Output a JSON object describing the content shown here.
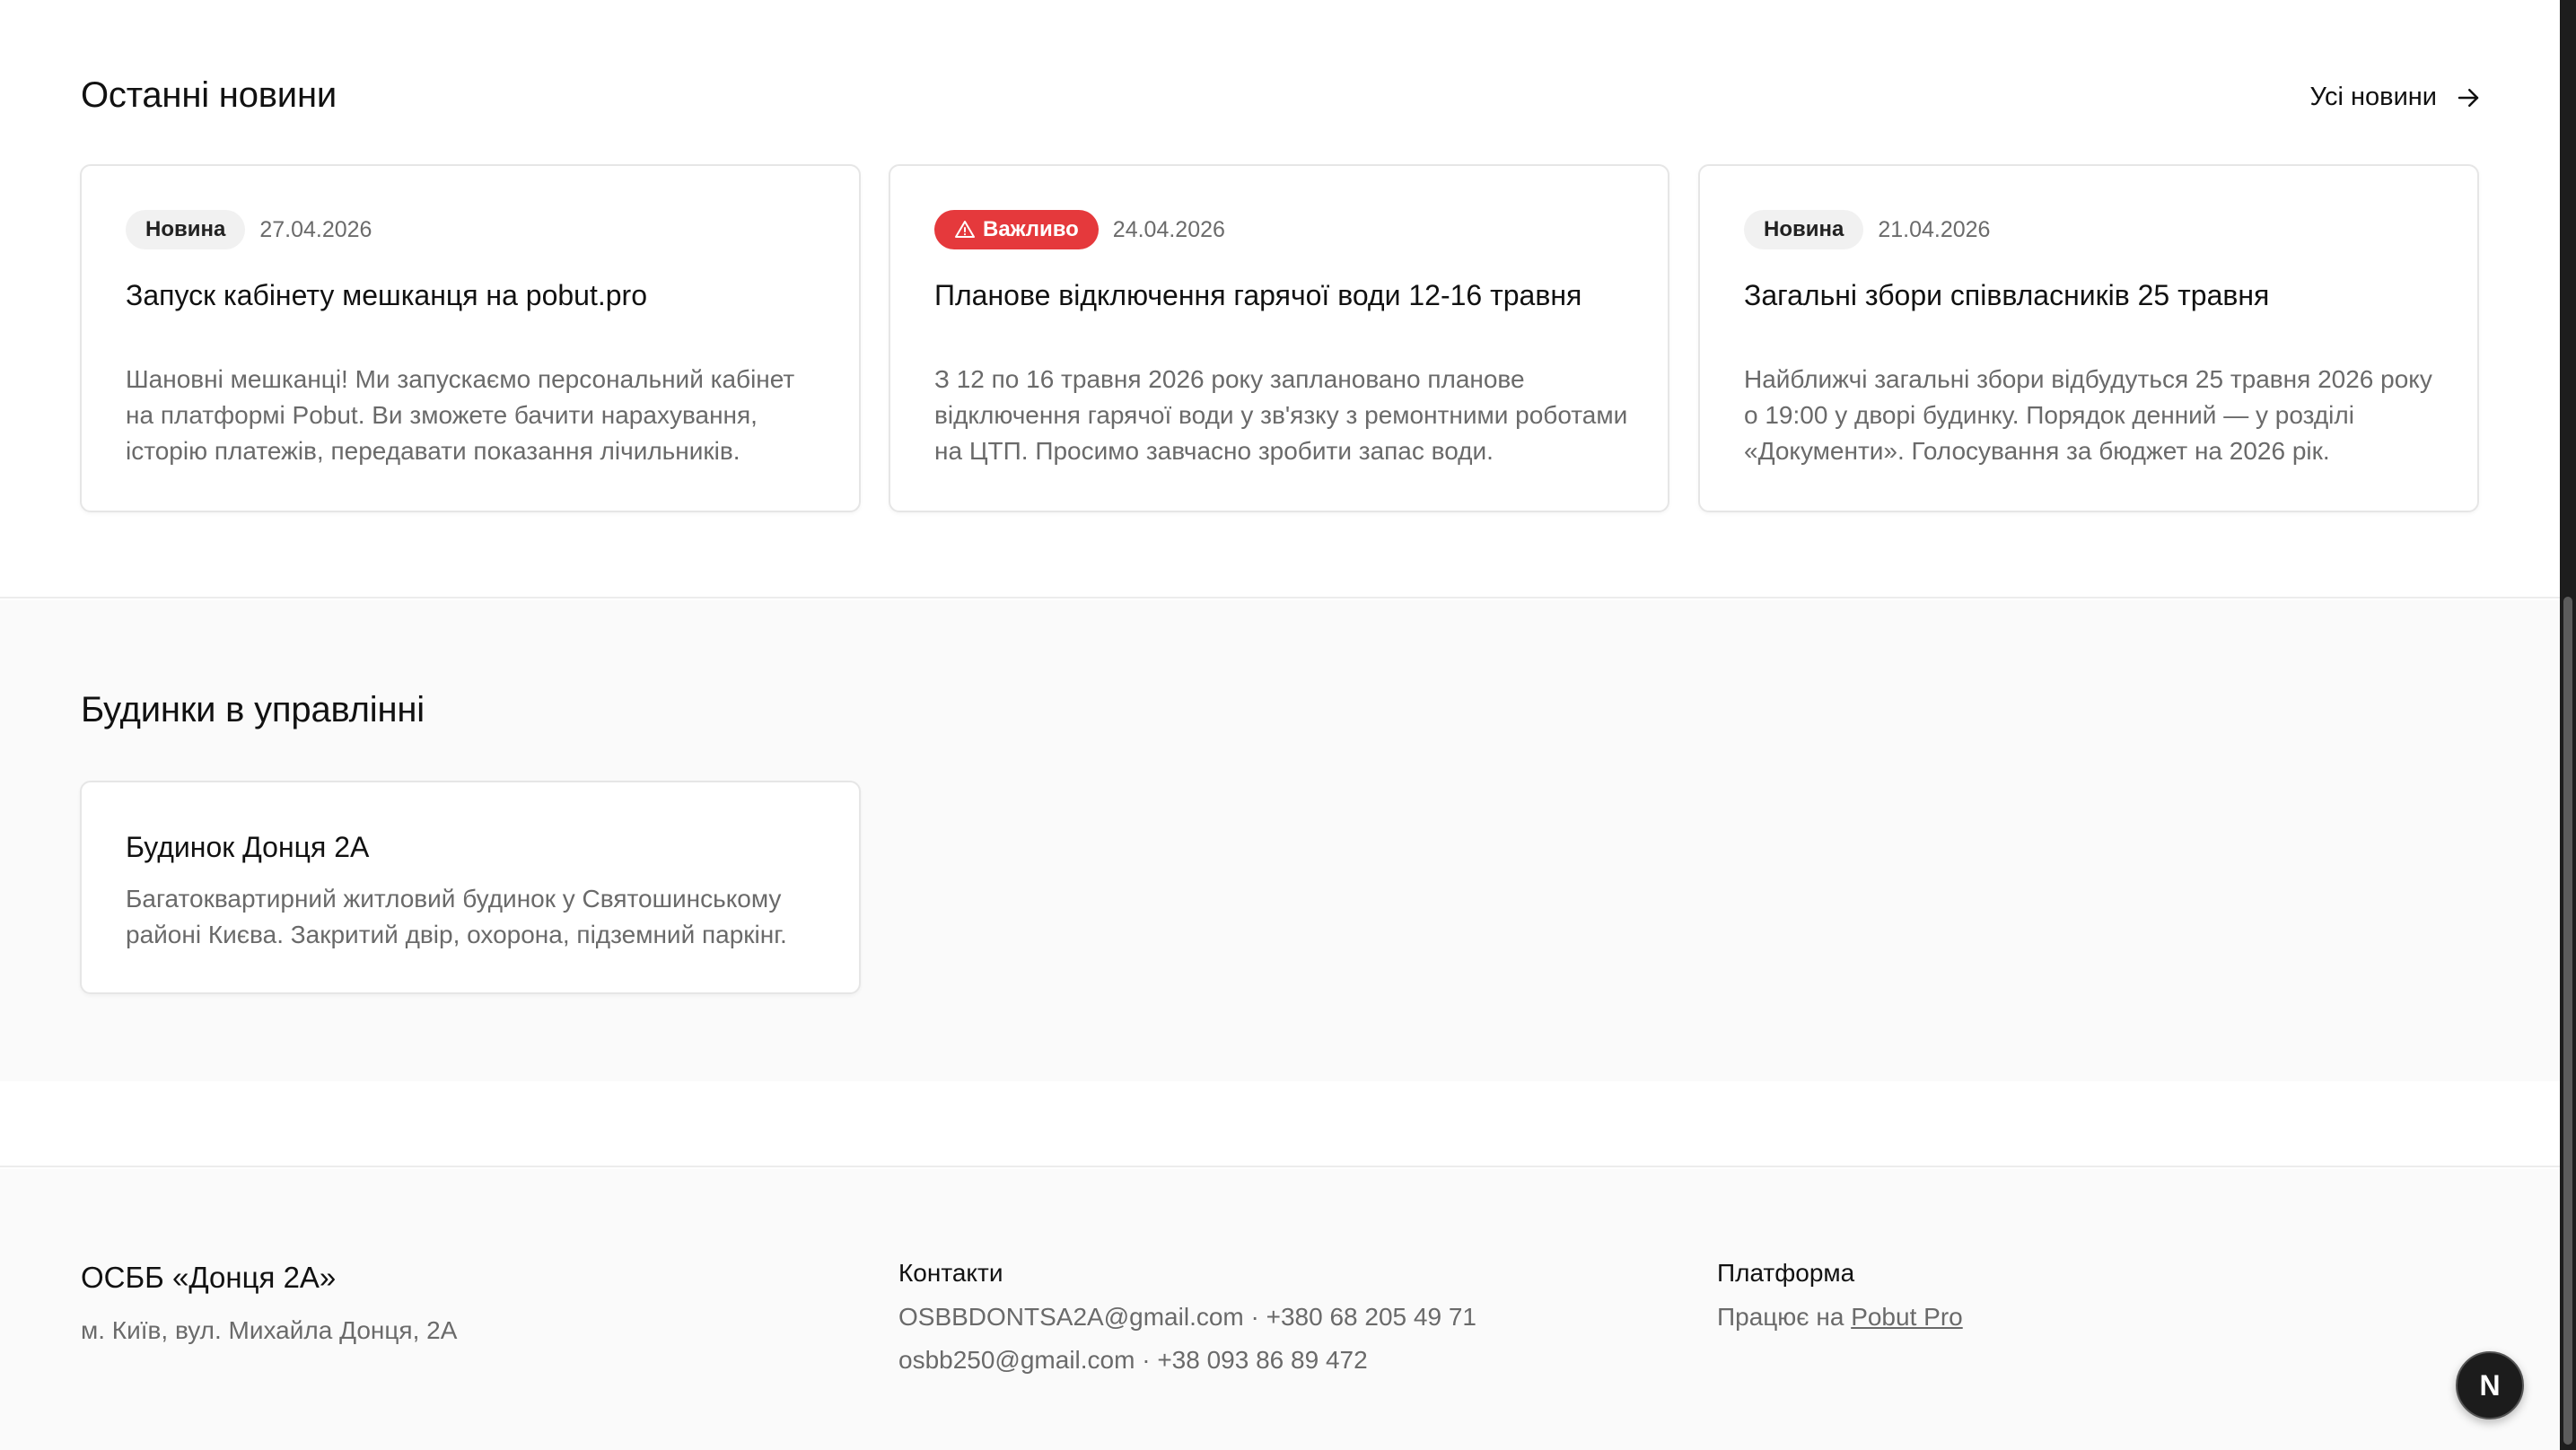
{
  "news": {
    "title": "Останні новини",
    "all_link": "Усі новини",
    "cards": [
      {
        "badge": "Новина",
        "badge_type": "new",
        "date": "27.04.2026",
        "title": "Запуск кабінету мешканця на pobut.pro",
        "text": "Шановні мешканці! Ми запускаємо персональний кабінет на платформі Pobut. Ви зможете бачити нарахування, історію платежів, передавати показання лічильників."
      },
      {
        "badge": "Важливо",
        "badge_type": "important",
        "date": "24.04.2026",
        "title": "Планове відключення гарячої води 12-16 травня",
        "text": "З 12 по 16 травня 2026 року заплановано планове відключення гарячої води у зв'язку з ремонтними роботами на ЦТП. Просимо завчасно зробити запас води."
      },
      {
        "badge": "Новина",
        "badge_type": "new",
        "date": "21.04.2026",
        "title": "Загальні збори співвласників 25 травня",
        "text": "Найближчі загальні збори відбудуться 25 травня 2026 року о 19:00 у дворі будинку. Порядок денний — у розділі «Документи». Голосування за бюджет на 2026 рік."
      }
    ]
  },
  "buildings": {
    "title": "Будинки в управлінні",
    "items": [
      {
        "name": "Будинок Донця 2А",
        "description": "Багатоквартирний житловий будинок у Святошинському районі Києва. Закритий двір, охорона, підземний паркінг."
      }
    ]
  },
  "footer": {
    "org_name": "ОСББ «Донця 2А»",
    "address": "м. Київ, вул. Михайла Донця, 2А",
    "contacts_heading": "Контакти",
    "contact_1": "OSBBDONTSA2A@gmail.com · +380 68 205 49 71",
    "contact_2": "osbb250@gmail.com · +38 093 86 89 472",
    "platform_heading": "Платформа",
    "platform_prefix": "Працює на",
    "platform_link": "Pobut Pro"
  },
  "fab": {
    "label": "N"
  },
  "colors": {
    "important_badge": "#e5393c",
    "new_badge": "#f1f1f1",
    "muted_text": "#6a6a6a",
    "section_bg": "#fafafa"
  },
  "icons": {
    "all_news": "arrow-right-icon",
    "important": "warning-triangle-icon"
  }
}
